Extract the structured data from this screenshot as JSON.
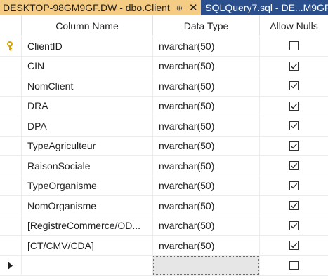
{
  "tabs": {
    "active": {
      "label": "DESKTOP-98GM9GF.DW - dbo.Client",
      "pin": "⊕",
      "close": "✕"
    },
    "inactive": {
      "label": "SQLQuery7.sql - DE...M9GF"
    }
  },
  "grid": {
    "headers": {
      "column_name": "Column Name",
      "data_type": "Data Type",
      "allow_nulls": "Allow Nulls"
    },
    "rows": [
      {
        "name": "ClientID",
        "type": "nvarchar(50)",
        "allow_nulls": false,
        "primary_key": true
      },
      {
        "name": "CIN",
        "type": "nvarchar(50)",
        "allow_nulls": true,
        "primary_key": false
      },
      {
        "name": "NomClient",
        "type": "nvarchar(50)",
        "allow_nulls": true,
        "primary_key": false
      },
      {
        "name": "DRA",
        "type": "nvarchar(50)",
        "allow_nulls": true,
        "primary_key": false
      },
      {
        "name": "DPA",
        "type": "nvarchar(50)",
        "allow_nulls": true,
        "primary_key": false
      },
      {
        "name": "TypeAgriculteur",
        "type": "nvarchar(50)",
        "allow_nulls": true,
        "primary_key": false
      },
      {
        "name": "RaisonSociale",
        "type": "nvarchar(50)",
        "allow_nulls": true,
        "primary_key": false
      },
      {
        "name": "TypeOrganisme",
        "type": "nvarchar(50)",
        "allow_nulls": true,
        "primary_key": false
      },
      {
        "name": "NomOrganisme",
        "type": "nvarchar(50)",
        "allow_nulls": true,
        "primary_key": false
      },
      {
        "name": "[RegistreCommerce/OD...",
        "type": "nvarchar(50)",
        "allow_nulls": true,
        "primary_key": false
      },
      {
        "name": "[CT/CMV/CDA]",
        "type": "nvarchar(50)",
        "allow_nulls": true,
        "primary_key": false
      }
    ],
    "new_row": {
      "name": "",
      "type": "",
      "allow_nulls": false
    }
  },
  "colors": {
    "tab_active_bg": "#f5cc84",
    "tab_strip_bg": "#2b4f8c",
    "key_icon": "#d9a400"
  },
  "icons": {
    "primary_key": "key-icon",
    "current_row": "arrow-right-icon",
    "checked": "checkmark-icon"
  }
}
